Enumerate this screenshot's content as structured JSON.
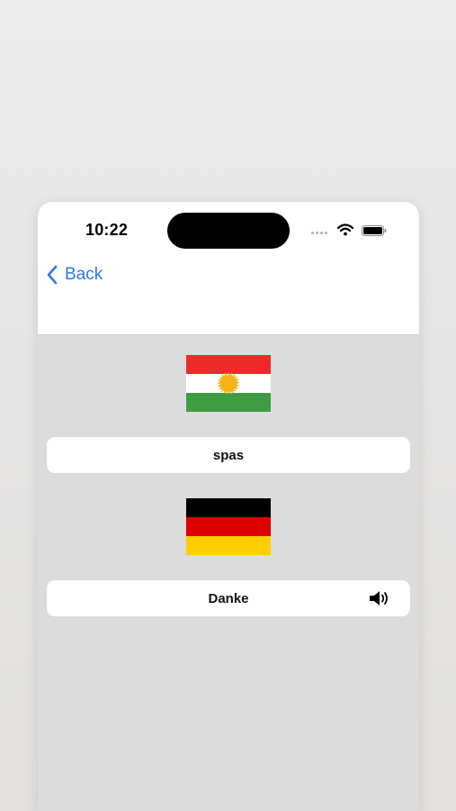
{
  "status_bar": {
    "time": "10:22",
    "icons": [
      "signal-dots-icon",
      "wifi-icon",
      "battery-icon"
    ]
  },
  "navigation": {
    "back_label": "Back",
    "back_icon": "chevron-left-icon",
    "accent_color": "#2f7ae0"
  },
  "source_language": {
    "flag": "kurdistan-flag-icon",
    "word": "spas"
  },
  "target_language": {
    "flag": "germany-flag-icon",
    "word": "Danke",
    "audio_icon": "speaker-icon"
  },
  "colors": {
    "content_background": "#dcdcdc",
    "card_background": "#ffffff"
  }
}
